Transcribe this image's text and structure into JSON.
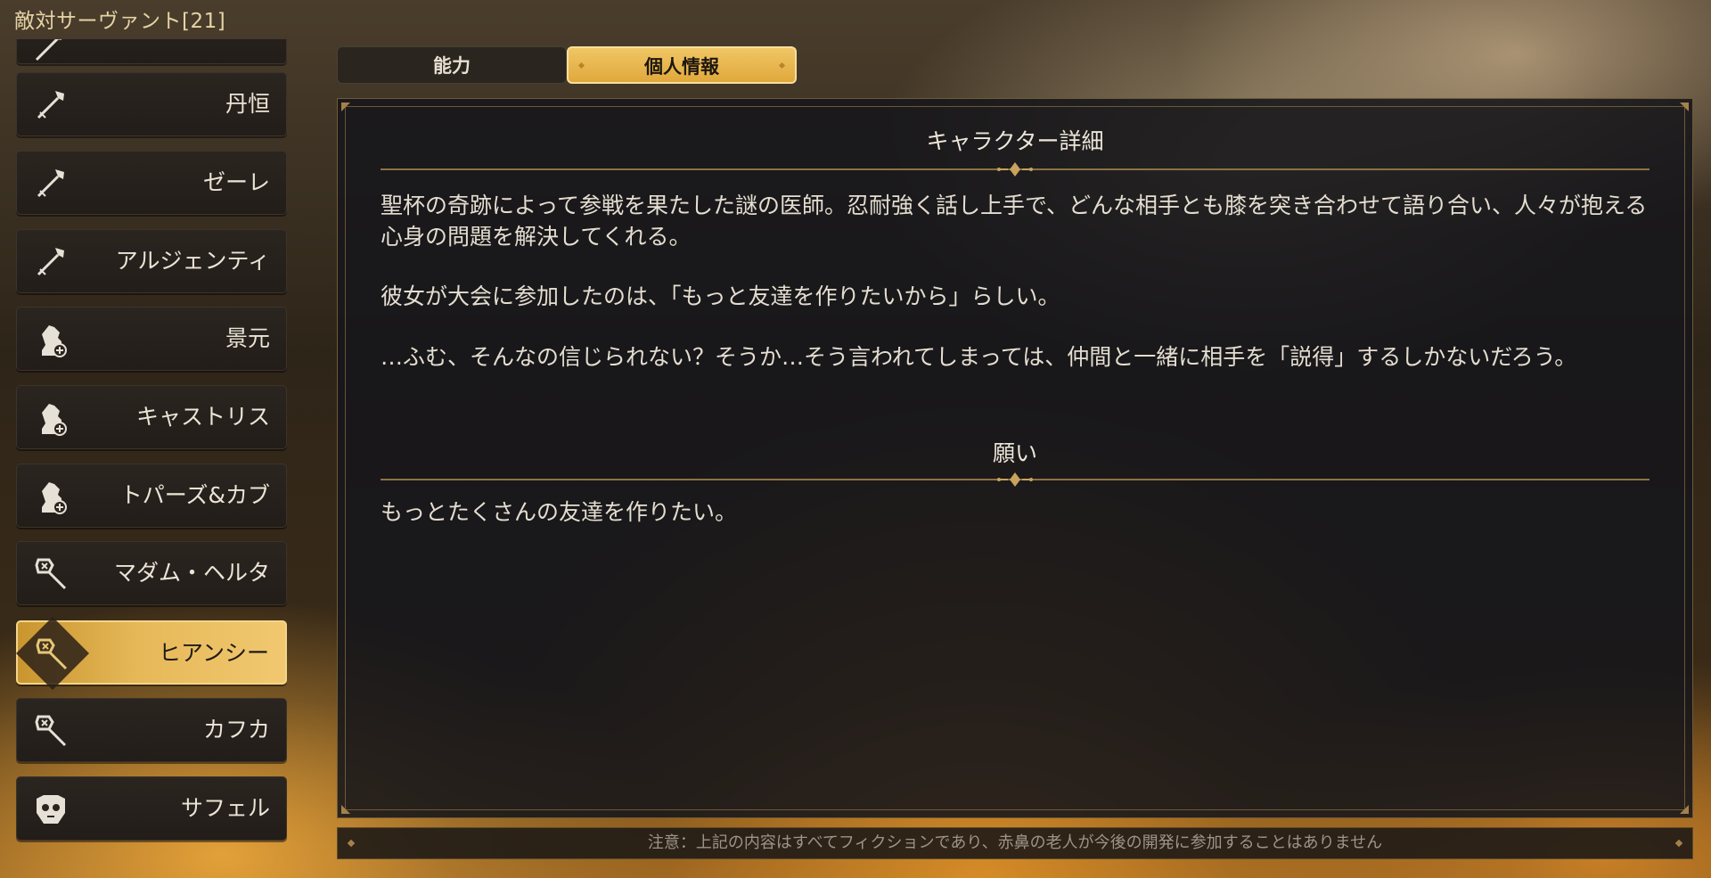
{
  "window": {
    "title": "敵対サーヴァント[21]"
  },
  "colors": {
    "accent_gold": "#e6b858",
    "panel_bg": "#16161a",
    "divider": "#8c7243"
  },
  "sidebar": {
    "items": [
      {
        "label": "",
        "icon": "spear-icon"
      },
      {
        "label": "丹恒",
        "icon": "spear-icon"
      },
      {
        "label": "ゼーレ",
        "icon": "spear-icon"
      },
      {
        "label": "アルジェンティ",
        "icon": "spear-icon"
      },
      {
        "label": "景元",
        "icon": "chess-knight-plus-icon"
      },
      {
        "label": "キャストリス",
        "icon": "chess-knight-plus-icon"
      },
      {
        "label": "トパーズ&カブ",
        "icon": "chess-knight-plus-icon"
      },
      {
        "label": "マダム・ヘルタ",
        "icon": "staff-icon"
      },
      {
        "label": "ヒアンシー",
        "icon": "staff-icon",
        "selected": true
      },
      {
        "label": "カフカ",
        "icon": "staff-icon"
      },
      {
        "label": "サフェル",
        "icon": "skull-mask-icon"
      }
    ]
  },
  "tabs": [
    {
      "label": "能力",
      "active": false
    },
    {
      "label": "個人情報",
      "active": true
    }
  ],
  "panel": {
    "detail_title": "キャラクター詳細",
    "paragraphs": [
      "聖杯の奇跡によって参戦を果たした謎の医師。忍耐強く話し上手で、どんな相手とも膝を突き合わせて語り合い、人々が抱える心身の問題を解決してくれる。",
      "彼女が大会に参加したのは、「もっと友達を作りたいから」らしい。",
      "…ふむ、そんなの信じられない？そうか…そう言われてしまっては、仲間と一緒に相手を「説得」するしかないだろう。"
    ],
    "wish_title": "願い",
    "wish_text": "もっとたくさんの友達を作りたい。"
  },
  "footer": {
    "notice": "注意：上記の内容はすべてフィクションであり、赤鼻の老人が今後の開発に参加することはありません"
  }
}
